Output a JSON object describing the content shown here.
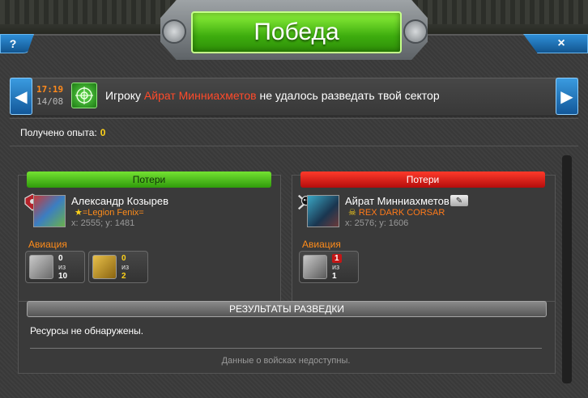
{
  "window": {
    "title": "Победа",
    "help_label": "?",
    "close_label": "×"
  },
  "message": {
    "time": "17:19",
    "date": "14/08",
    "text_before": "Игроку ",
    "player": "Айрат Минниахметов",
    "text_after": " не удалось разведать твой сектор",
    "prev_label": "◀",
    "next_label": "▶"
  },
  "experience": {
    "label": "Получено опыта:",
    "value": "0"
  },
  "attacker": {
    "losses_label": "Потери",
    "name": "Александр Козырев",
    "clan": "=Legion Fenix=",
    "coords": "x: 2555; y: 1481",
    "category": "Авиация",
    "units": [
      {
        "lost": "0",
        "of": "из",
        "total": "10"
      },
      {
        "lost": "0",
        "of": "из",
        "total": "2"
      }
    ]
  },
  "defender": {
    "losses_label": "Потери",
    "name": "Айрат Минниахметов",
    "clan": "REX DARK CORSAR",
    "coords": "x: 2576; y: 1606",
    "category": "Авиация",
    "units": [
      {
        "lost": "1",
        "of": "из",
        "total": "1"
      }
    ]
  },
  "results": {
    "title": "РЕЗУЛЬТАТЫ РАЗВЕДКИ",
    "resources": "Ресурсы не обнаружены.",
    "troops": "Данные о войсках недоступны."
  },
  "colors": {
    "title_green": "#3dac0e",
    "attacker_header": "#4cc41a",
    "defender_header": "#d4150f",
    "player_highlight": "#ff4a2a",
    "category": "#ff8c1a",
    "xp_value": "#ffd21a",
    "defender_clan": "#ff7a1a"
  }
}
